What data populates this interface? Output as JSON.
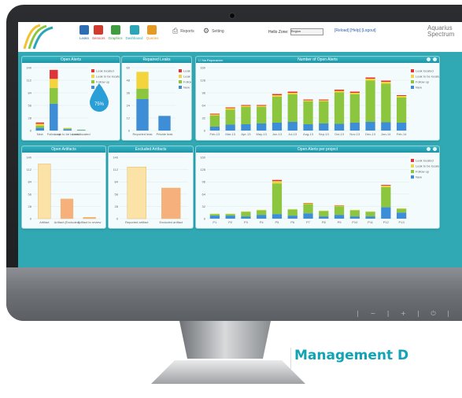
{
  "colors": {
    "teal": "#30a9b4",
    "panel_head": "#1e95a6",
    "blue": "#3d8ed6",
    "green": "#8cc63f",
    "yellow": "#f3d43c",
    "red": "#e0343b",
    "cream": "#fbe3a8",
    "orange": "#f6b07c"
  },
  "nav": {
    "items": [
      {
        "label": "Leaks",
        "icon": "leak-icon",
        "color": "#2d6db3"
      },
      {
        "label": "Sensors",
        "icon": "sensor-icon",
        "color": "#d23a2e"
      },
      {
        "label": "Graphics",
        "icon": "graphic-icon",
        "color": "#3f9c3f"
      },
      {
        "label": "Dashboard",
        "icon": "dashboard-icon",
        "color": "#2aa6b8"
      },
      {
        "label": "Queries",
        "icon": "query-icon",
        "color": "#e69a23"
      }
    ],
    "reports": "Reports",
    "setting": "Setting",
    "zone_label": "Hello Zone:",
    "zone_value": "Region",
    "links": "[Reload] [Help] [Logout]",
    "logo_line1": "Aquarius",
    "logo_line2": "Spectrum"
  },
  "panels": {
    "open_alerts": {
      "title": "Open Alerts",
      "badge": "75%"
    },
    "repaired_leaks": {
      "title": "Repaired Leaks"
    },
    "num_open_alerts": {
      "title": "Number of Open Alerts",
      "checkbox": "Na Reparación"
    },
    "open_artifacts": {
      "title": "Open Artifacts"
    },
    "excluded_artifacts": {
      "title": "Excluded Artifacts"
    },
    "open_alerts_by_project": {
      "title": "Open Alerts per project"
    }
  },
  "legend": [
    "Leak located",
    "Leak to be located",
    "Follow up",
    "New"
  ],
  "chart_data": [
    {
      "type": "bar",
      "title": "Open Alerts",
      "categories": [
        "New",
        "Follow up",
        "Leak to be located",
        "Leak located"
      ],
      "series": [
        {
          "name": "New",
          "values": [
            6,
            60,
            3,
            1
          ]
        },
        {
          "name": "Follow up",
          "values": [
            5,
            35,
            2,
            1
          ]
        },
        {
          "name": "Leak to be located",
          "values": [
            4,
            20,
            1,
            0
          ]
        },
        {
          "name": "Leak located",
          "values": [
            3,
            20,
            0,
            0
          ]
        }
      ],
      "ylim": [
        0,
        140
      ]
    },
    {
      "type": "bar",
      "title": "Repaired Leaks",
      "categories": [
        "Reported leak",
        "Private leak"
      ],
      "series": [
        {
          "name": "New",
          "values": [
            30,
            14
          ]
        },
        {
          "name": "Follow up",
          "values": [
            10,
            0
          ]
        },
        {
          "name": "Leak to be located",
          "values": [
            16,
            0
          ]
        }
      ],
      "ylim": [
        0,
        60
      ]
    },
    {
      "type": "bar",
      "title": "Number of Open Alerts",
      "categories": [
        "Feb-13",
        "Mar-13",
        "Apr-13",
        "May-13",
        "Jun-13",
        "Jul-13",
        "Aug-13",
        "Sep-13",
        "Oct-13",
        "Nov-13",
        "Dec-13",
        "Jan-14",
        "Feb-14"
      ],
      "series": [
        {
          "name": "New",
          "values": [
            10,
            15,
            16,
            18,
            20,
            22,
            16,
            18,
            17,
            20,
            22,
            21,
            20
          ]
        },
        {
          "name": "Follow up",
          "values": [
            28,
            38,
            44,
            42,
            66,
            70,
            58,
            56,
            80,
            72,
            105,
            98,
            64
          ]
        },
        {
          "name": "Leak to be located",
          "values": [
            3,
            4,
            3,
            3,
            4,
            4,
            3,
            3,
            4,
            4,
            5,
            5,
            4
          ]
        },
        {
          "name": "Leak located",
          "values": [
            2,
            2,
            2,
            2,
            3,
            3,
            2,
            2,
            3,
            3,
            3,
            3,
            2
          ]
        }
      ],
      "ylim": [
        0,
        160
      ]
    },
    {
      "type": "bar",
      "title": "Open Artifacts",
      "categories": [
        "Artifact",
        "Artifact (Excluded)",
        "Artifact to review"
      ],
      "values": [
        125,
        45,
        3
      ],
      "ylim": [
        0,
        140
      ]
    },
    {
      "type": "bar",
      "title": "Excluded Artifacts",
      "categories": [
        "Reported artifact",
        "Excluded artifact"
      ],
      "values": [
        118,
        70
      ],
      "ylim": [
        0,
        140
      ]
    },
    {
      "type": "bar",
      "title": "Open Alerts per project",
      "categories": [
        "P1",
        "P2",
        "P3",
        "P4",
        "P5",
        "P6",
        "P7",
        "P8",
        "P9",
        "P10",
        "P11",
        "P12",
        "P13"
      ],
      "series": [
        {
          "name": "New",
          "values": [
            8,
            8,
            6,
            10,
            12,
            8,
            14,
            6,
            10,
            6,
            6,
            30,
            16
          ]
        },
        {
          "name": "Follow up",
          "values": [
            4,
            4,
            12,
            12,
            80,
            16,
            24,
            14,
            22,
            16,
            12,
            52,
            10
          ]
        },
        {
          "name": "Leak to be located",
          "values": [
            1,
            1,
            1,
            1,
            6,
            1,
            2,
            1,
            2,
            1,
            1,
            4,
            1
          ]
        },
        {
          "name": "Leak located",
          "values": [
            0,
            0,
            0,
            0,
            3,
            0,
            1,
            0,
            1,
            0,
            0,
            2,
            0
          ]
        }
      ],
      "ylim": [
        0,
        160
      ]
    }
  ],
  "caption": "Management D"
}
